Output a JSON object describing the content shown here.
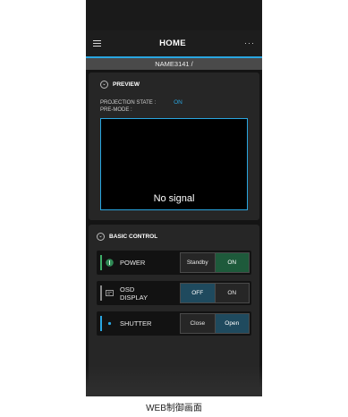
{
  "header": {
    "title": "HOME",
    "more": "···"
  },
  "device_name": "NAME3141 /",
  "preview": {
    "section_title": "PREVIEW",
    "projection_state_label": "PROJECTION STATE :",
    "projection_state_value": "ON",
    "pre_mode_label": "PRE-MODE :",
    "screen_text": "No signal"
  },
  "basic_control": {
    "section_title": "BASIC CONTROL",
    "power": {
      "label": "POWER",
      "left": "Standby",
      "right": "ON",
      "selected": "right"
    },
    "osd": {
      "label_line1": "OSD",
      "label_line2": "DISPLAY",
      "left": "OFF",
      "right": "ON",
      "selected": "left"
    },
    "shutter": {
      "label": "SHUTTER",
      "left": "Close",
      "right": "Open",
      "selected": "right"
    }
  },
  "caption": "WEB制御画面",
  "colors": {
    "accent": "#2aa6e0",
    "power_green": "#1e5a3b",
    "selected_blue": "#1f4a5e"
  }
}
